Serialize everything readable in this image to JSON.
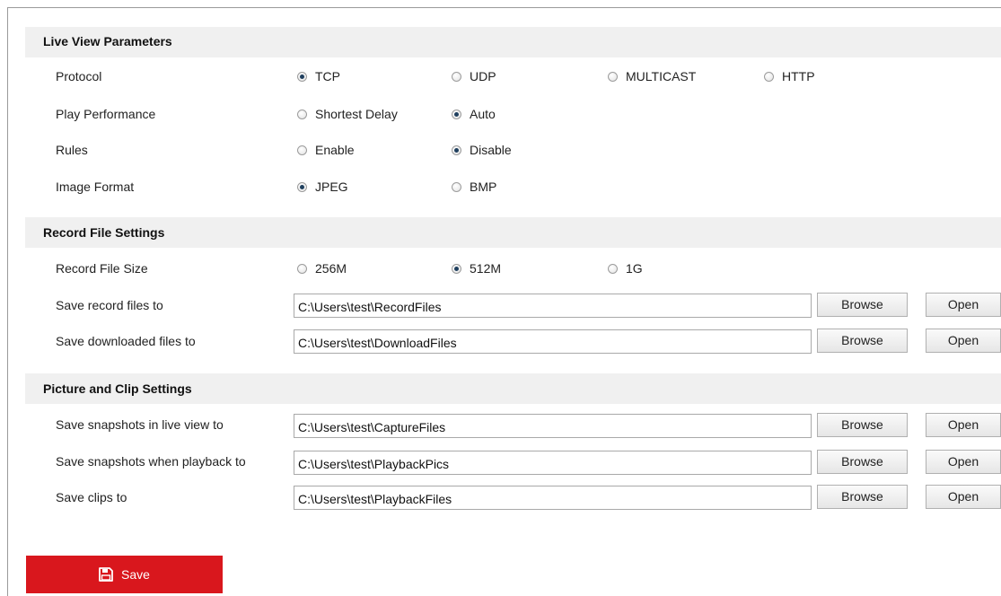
{
  "live_view": {
    "title": "Live View Parameters",
    "protocol": {
      "label": "Protocol",
      "options": [
        "TCP",
        "UDP",
        "MULTICAST",
        "HTTP"
      ],
      "selected": "TCP"
    },
    "play_performance": {
      "label": "Play Performance",
      "options": [
        "Shortest Delay",
        "Auto"
      ],
      "selected": "Auto"
    },
    "rules": {
      "label": "Rules",
      "options": [
        "Enable",
        "Disable"
      ],
      "selected": "Disable"
    },
    "image_format": {
      "label": "Image Format",
      "options": [
        "JPEG",
        "BMP"
      ],
      "selected": "JPEG"
    }
  },
  "record_file": {
    "title": "Record File Settings",
    "size": {
      "label": "Record File Size",
      "options": [
        "256M",
        "512M",
        "1G"
      ],
      "selected": "512M"
    },
    "record_path": {
      "label": "Save record files to",
      "value": "C:\\Users\\test\\RecordFiles"
    },
    "download_path": {
      "label": "Save downloaded files to",
      "value": "C:\\Users\\test\\DownloadFiles"
    }
  },
  "picture_clip": {
    "title": "Picture and Clip Settings",
    "snapshot_live_path": {
      "label": "Save snapshots in live view to",
      "value": "C:\\Users\\test\\CaptureFiles"
    },
    "snapshot_playback_path": {
      "label": "Save snapshots when playback to",
      "value": "C:\\Users\\test\\PlaybackPics"
    },
    "clips_path": {
      "label": "Save clips to",
      "value": "C:\\Users\\test\\PlaybackFiles"
    }
  },
  "buttons": {
    "browse": "Browse",
    "open": "Open",
    "save": "Save"
  },
  "icons": {
    "save": "floppy-disk-icon"
  },
  "colors": {
    "accent": "#d9171d",
    "section_bg": "#f0f0f0"
  }
}
